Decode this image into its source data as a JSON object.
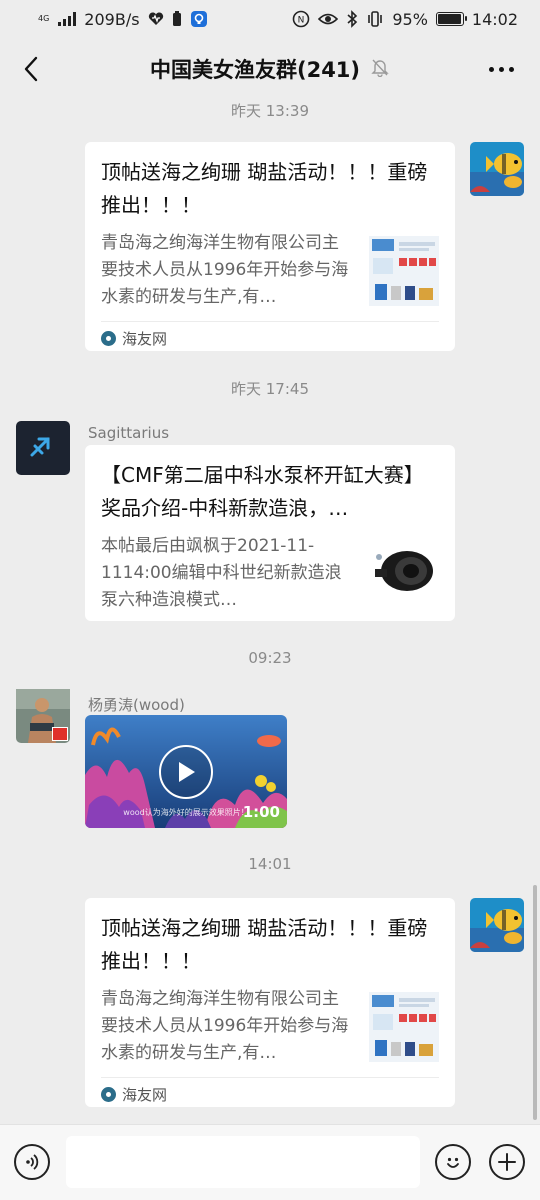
{
  "status_bar": {
    "network_gen": "4G",
    "net_speed": "209B/s",
    "battery_pct": "95%",
    "time": "14:02"
  },
  "header": {
    "title": "中国美女渔友群(241)"
  },
  "messages": [
    {
      "type": "timestamp",
      "text": "昨天 13:39"
    },
    {
      "type": "link_card",
      "side": "right",
      "title": "顶帖送海之绚珊 瑚盐活动！！！重磅推出！！！",
      "desc": "青岛海之绚海洋生物有限公司主要技术人员从1996年开始参与海水素的研发与生产,有…",
      "source": "海友网"
    },
    {
      "type": "timestamp",
      "text": "昨天 17:45"
    },
    {
      "type": "link_card",
      "side": "left",
      "sender": "Sagittarius",
      "avatar_text": "sagittarius",
      "title": "【CMF第二届中科水泵杯开缸大赛】奖品介绍-中科新款造浪，…",
      "desc": "本帖最后由飒枫于2021-11-1114:00编辑中科世纪新款造浪泵六种造浪模式…"
    },
    {
      "type": "timestamp",
      "text": "09:23"
    },
    {
      "type": "video",
      "side": "left",
      "sender": "杨勇涛(wood)",
      "duration": "1:00",
      "caption": "wood认为海外好的展示效果照片！"
    },
    {
      "type": "timestamp",
      "text": "14:01"
    },
    {
      "type": "link_card",
      "side": "right",
      "title": "顶帖送海之绚珊 瑚盐活动！！！重磅推出！！！",
      "desc": "青岛海之绚海洋生物有限公司主要技术人员从1996年开始参与海水素的研发与生产,有…",
      "source": "海友网"
    }
  ],
  "input": {
    "value": "",
    "placeholder": ""
  },
  "icons": {
    "back": "back-arrow-icon",
    "mute": "bell-mute-icon",
    "more": "more-icon",
    "voice": "voice-icon",
    "emoji": "emoji-icon",
    "plus": "plus-icon"
  },
  "colors": {
    "chat_bg": "#ededed",
    "bubble": "#ffffff",
    "timestamp": "#8a8a8a"
  }
}
